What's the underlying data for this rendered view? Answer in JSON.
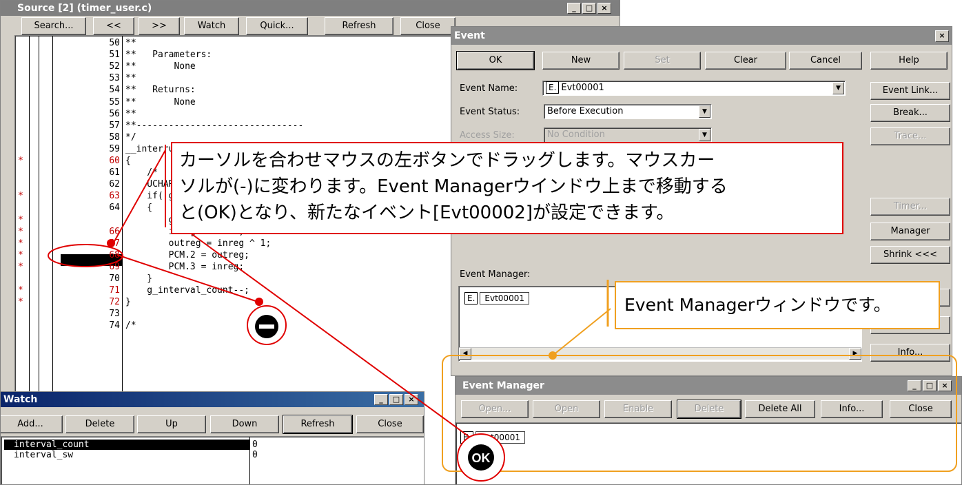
{
  "source": {
    "title": "Source [2] (timer_user.c)",
    "toolbar": [
      "Search...",
      "<<",
      ">>",
      "Watch",
      "Quick...",
      "Refresh",
      "Close"
    ],
    "lines": [
      {
        "num": "50",
        "mark": "",
        "code": "**"
      },
      {
        "num": "51",
        "mark": "",
        "code": "**   Parameters:"
      },
      {
        "num": "52",
        "mark": "",
        "code": "**       None"
      },
      {
        "num": "53",
        "mark": "",
        "code": "**"
      },
      {
        "num": "54",
        "mark": "",
        "code": "**   Returns:"
      },
      {
        "num": "55",
        "mark": "",
        "code": "**       None"
      },
      {
        "num": "56",
        "mark": "",
        "code": "**"
      },
      {
        "num": "57",
        "mark": "",
        "code": "**-------------------------------"
      },
      {
        "num": "58",
        "mark": "",
        "code": "*/"
      },
      {
        "num": "59",
        "mark": "",
        "code": "__interrupt void"
      },
      {
        "num": "60",
        "mark": "*",
        "code": "{"
      },
      {
        "num": "61",
        "mark": "",
        "code": "    /*"
      },
      {
        "num": "62",
        "mark": "",
        "code": "    UCHAR"
      },
      {
        "num": "63",
        "mark": "*",
        "code": "    if( g_interval_count == 0 )"
      },
      {
        "num": "64",
        "mark": "",
        "code": "    {"
      },
      {
        "num": "65",
        "mark": "*",
        "code": "        g_interval_count = g_counter_data[ g_"
      },
      {
        "num": "66",
        "mark": "*",
        "code": "        inreg = PCM.2;"
      },
      {
        "num": "67",
        "mark": "*",
        "code": "        outreg = inreg ^ 1;"
      },
      {
        "num": "68",
        "mark": "*",
        "code": "        PCM.2 = outreg;"
      },
      {
        "num": "69",
        "mark": "*",
        "code": "        PCM.3 = inreg;"
      },
      {
        "num": "70",
        "mark": "",
        "code": "    }"
      },
      {
        "num": "71",
        "mark": "*",
        "code": "    g_interval_count--;"
      },
      {
        "num": "72",
        "mark": "*",
        "code": "}"
      },
      {
        "num": "73",
        "mark": "",
        "code": ""
      },
      {
        "num": "74",
        "mark": "",
        "code": "/*"
      }
    ]
  },
  "watch": {
    "title": "Watch",
    "toolbar": [
      "Add...",
      "Delete",
      "Up",
      "Down",
      "Refresh",
      "Close"
    ],
    "rows": [
      {
        "name": "interval_count",
        "value": "0"
      },
      {
        "name": "interval_sw",
        "value": "0"
      }
    ]
  },
  "event": {
    "title": "Event",
    "close": "×",
    "top_buttons": [
      "OK",
      "New",
      "Set",
      "Clear",
      "Cancel",
      "Help"
    ],
    "side_buttons": [
      "Event Link...",
      "Break...",
      "Trace...",
      "Timer...",
      "Manager",
      "Shrink <<<",
      "Info..."
    ],
    "name_label": "Event Name:",
    "name_badge": "E.",
    "name_value": "Evt00001",
    "status_label": "Event Status:",
    "status_value": "Before Execution",
    "access_label": "Access Size:",
    "access_value": "No Condition",
    "manager_label": "Event Manager:",
    "manager_item_badge": "E.",
    "manager_item": "Evt00001"
  },
  "event_manager": {
    "title": "Event Manager",
    "buttons": [
      "Open...",
      "Open",
      "Enable",
      "Delete",
      "Delete All",
      "Info...",
      "Close"
    ],
    "item_badge": "E.",
    "item": "Evt00001"
  },
  "callouts": {
    "main_line1": "カーソルを合わせマウスの左ボタンでドラッグします。マウスカー",
    "main_line2": "ソルが(-)に変わります。Event Managerウインドウ上まで移動する",
    "main_line3": "と(OK)となり、新たなイベント[Evt00002]が設定できます。",
    "manager_note": "Event Managerウィンドウです。",
    "ok_badge": "OK",
    "minus_badge": "−"
  },
  "colors": {
    "red": "#e00000",
    "orange": "#f0a020",
    "titlebar": "#0a246a"
  }
}
